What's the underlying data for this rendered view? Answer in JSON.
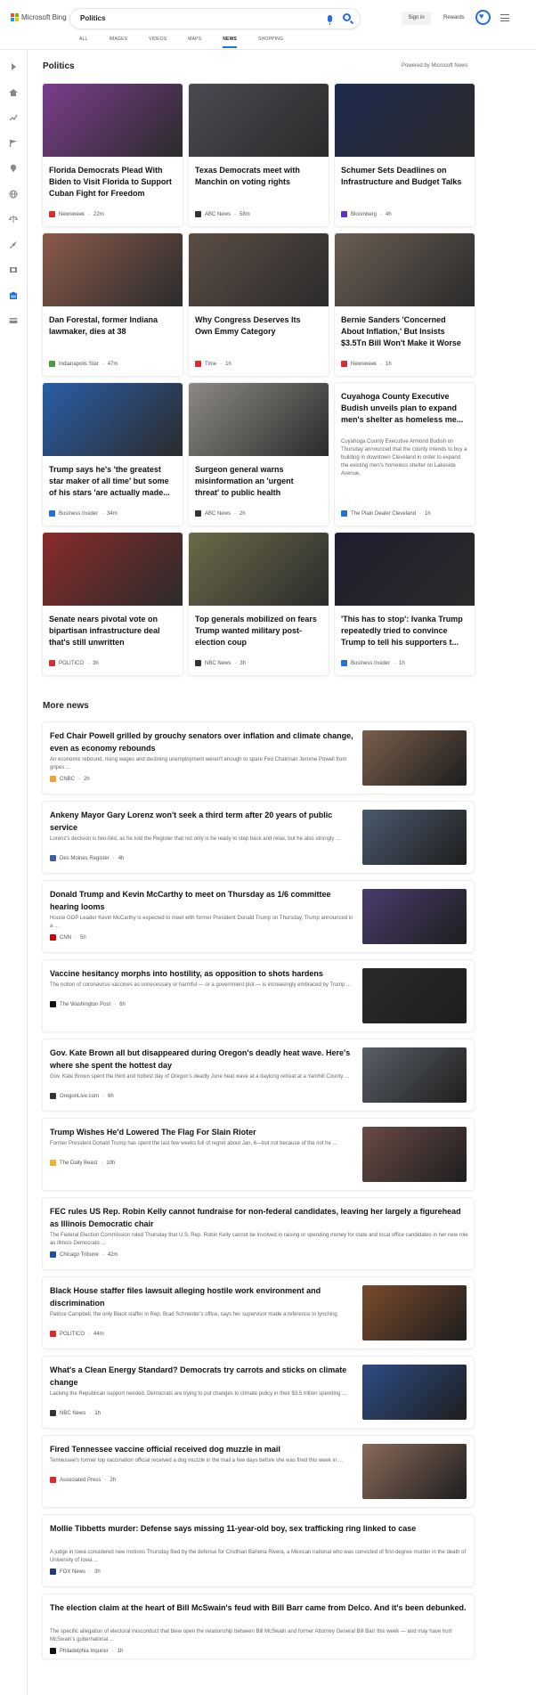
{
  "header": {
    "logo_text": "Microsoft Bing",
    "search_query": "Politics",
    "signin_label": "Sign in",
    "rewards_label": "Rewards",
    "scopes": [
      {
        "label": "ALL",
        "active": false
      },
      {
        "label": "IMAGES",
        "active": false
      },
      {
        "label": "VIDEOS",
        "active": false
      },
      {
        "label": "MAPS",
        "active": false
      },
      {
        "label": "NEWS",
        "active": true
      },
      {
        "label": "SHOPPING",
        "active": false
      }
    ]
  },
  "sidebar": {
    "icons": [
      "expand-arrow-icon",
      "home-icon",
      "trending-icon",
      "flag-icon",
      "location-pin-icon",
      "globe-icon",
      "scales-icon",
      "rocket-icon",
      "film-icon",
      "building-icon",
      "credit-card-icon"
    ]
  },
  "top_section": {
    "title": "Politics",
    "powered_by": "Powered by Microsoft News",
    "cards": [
      {
        "title": "Florida Democrats Plead With Biden to Visit Florida to Support Cuban Fight for Freedom",
        "source": "Newsweek",
        "time": "22m",
        "src_color": "#e0282d",
        "img_color": "#7a3d8c"
      },
      {
        "title": "Texas Democrats meet with Manchin on voting rights",
        "source": "ABC News",
        "time": "58m",
        "src_color": "#333333",
        "img_color": "#4a4a52"
      },
      {
        "title": "Schumer Sets Deadlines on Infrastructure and Budget Talks",
        "source": "Bloomberg",
        "time": "4h",
        "src_color": "#5b2fd6",
        "img_color": "#1d2a4e"
      },
      {
        "title": "Dan Forestal, former Indiana lawmaker, dies at 38",
        "source": "Indianapolis Star",
        "time": "47m",
        "src_color": "#4a9a3f",
        "img_color": "#8a5a4a"
      },
      {
        "title": "Why Congress Deserves Its Own Emmy Category",
        "source": "Time",
        "time": "1h",
        "src_color": "#e0282d",
        "img_color": "#5b4d44"
      },
      {
        "title": "Bernie Sanders 'Concerned About Inflation,' But Insists $3.5Tn Bill Won't Make it Worse",
        "source": "Newsweek",
        "time": "1h",
        "src_color": "#e0282d",
        "img_color": "#6a5d52"
      },
      {
        "title": "Trump says he's 'the greatest star maker of all time' but some of his stars 'are actually made...",
        "source": "Business Insider",
        "time": "34m",
        "src_color": "#1f6fe5",
        "img_color": "#2a5ea8"
      },
      {
        "title": "Surgeon general warns misinformation an 'urgent threat' to public health",
        "source": "ABC News",
        "time": "2h",
        "src_color": "#333333",
        "img_color": "#8d8a84"
      },
      {
        "title": "Cuyahoga County Executive Budish unveils plan to expand men's shelter as homeless me...",
        "snippet": "Cuyahoga County Executive Armond Budish on Thursday announced that the county intends to buy a building in downtown Cleveland in order to expand the existing men's homeless shelter on Lakeside Avenue.",
        "source": "The Plain Dealer Cleveland",
        "time": "1h",
        "src_color": "#1f6fe5",
        "img_color": ""
      },
      {
        "title": "Senate nears pivotal vote on bipartisan infrastructure deal that's still unwritten",
        "source": "POLITICO",
        "time": "3h",
        "src_color": "#e0282d",
        "img_color": "#8a2b2b"
      },
      {
        "title": "Top generals mobilized on fears Trump wanted military post-election coup",
        "source": "NBC News",
        "time": "3h",
        "src_color": "#333333",
        "img_color": "#6b6a4a"
      },
      {
        "title": "'This has to stop': Ivanka Trump repeatedly tried to convince Trump to tell his supporters t...",
        "source": "Business Insider",
        "time": "1h",
        "src_color": "#1f6fe5",
        "img_color": "#1e1e30"
      }
    ]
  },
  "more_news": {
    "title": "More news",
    "items": [
      {
        "title": "Fed Chair Powell grilled by grouchy senators over inflation and climate change, even as economy rebounds",
        "snippet": "An economic rebound, rising wages and declining unemployment weren't enough to spare Fed Chairman Jerome Powell from gripes ...",
        "source": "CNBC",
        "time": "2h",
        "src_color": "#f2a233",
        "thumb_color": "#7a5e4a"
      },
      {
        "title": "Ankeny Mayor Gary Lorenz won't seek a third term after 20 years of public service",
        "snippet": "Lorenz's decision is two-fold, as he told the Register that not only is he ready to step back and relax, but he also strongly ...",
        "source": "Des Moines Register",
        "time": "4h",
        "src_color": "#3a5fb0",
        "thumb_color": "#4a5a6e"
      },
      {
        "title": "Donald Trump and Kevin McCarthy to meet on Thursday as 1/6 committee hearing looms",
        "snippet": "House GOP Leader Kevin McCarthy is expected to meet with former President Donald Trump on Thursday, Trump announced in a ...",
        "source": "CNN",
        "time": "5h",
        "src_color": "#cc0000",
        "thumb_color": "#4a3b6e"
      },
      {
        "title": "Vaccine hesitancy morphs into hostility, as opposition to shots hardens",
        "snippet": "The notion of coronavirus vaccines as unnecessary or harmful — or a government plot — is increasingly embraced by Trump ...",
        "source": "The Washington Post",
        "time": "6h",
        "src_color": "#111111",
        "thumb_color": "#2a2a2a"
      },
      {
        "title": "Gov. Kate Brown all but disappeared during Oregon's deadly heat wave. Here's where she spent the hottest day",
        "snippet": "Gov. Kate Brown spent the third and hottest day of Oregon's deadly June heat wave at a daylong retreat at a Yamhill County ...",
        "source": "OregonLive.com",
        "time": "6h",
        "src_color": "#333333",
        "thumb_color": "#5a6068"
      },
      {
        "title": "Trump Wishes He'd Lowered The Flag For Slain Rioter",
        "snippet": "Former President Donald Trump has spent the last few weeks full of regret about Jan. 6—but not because of the riot he ...",
        "source": "The Daily Beast",
        "time": "10h",
        "src_color": "#f2b233",
        "thumb_color": "#6a4a44"
      },
      {
        "title": "FEC rules US Rep. Robin Kelly cannot fundraise for non-federal candidates, leaving her largely a figurehead as Illinois Democratic chair",
        "snippet": "The Federal Election Commission ruled Thursday that U.S. Rep. Robin Kelly cannot be involved in raising or spending money for state and local office candidates in her new role as Illinois Democratic ...",
        "source": "Chicago Tribune",
        "time": "42m",
        "src_color": "#1f4fa5",
        "thumb_color": ""
      },
      {
        "title": "Black House staffer files lawsuit alleging hostile work environment and discrimination",
        "snippet": "Patrice Campbell, the only Black staffer in Rep. Brad Schneider's office, says her supervisor made a reference to lynching",
        "source": "POLITICO",
        "time": "44m",
        "src_color": "#e0282d",
        "thumb_color": "#7a4a2a"
      },
      {
        "title": "What's a Clean Energy Standard? Democrats try carrots and sticks on climate change",
        "snippet": "Lacking the Republican support needed, Democrats are trying to put changes to climate policy in their $3.5 trillion spending ...",
        "source": "NBC News",
        "time": "1h",
        "src_color": "#333333",
        "thumb_color": "#2e4c86"
      },
      {
        "title": "Fired Tennessee vaccine official received dog muzzle in mail",
        "snippet": "Tennessee's former top vaccination official received a dog muzzle in the mail a few days before she was fired this week in ...",
        "source": "Associated Press",
        "time": "2h",
        "src_color": "#e0282d",
        "thumb_color": "#8a6a5a"
      },
      {
        "title": "Mollie Tibbetts murder: Defense says missing 11-year-old boy, sex trafficking ring linked to case",
        "snippet": "A judge in Iowa considered new motions Thursday filed by the defense for Cristhian Bahena Rivera, a Mexican national who was convicted of first-degree murder in the death of University of Iowa ...",
        "source": "FOX News",
        "time": "3h",
        "src_color": "#1f3a7a",
        "thumb_color": ""
      },
      {
        "title": "The election claim at the heart of Bill McSwain's feud with Bill Barr came from Delco. And it's been debunked.",
        "snippet": "The specific allegation of electoral misconduct that blew open the relationship between Bill McSwain and former Attorney General Bill Barr this week — and may have hurt McSwain's gubernatorial ...",
        "source": "Philadelphia Inquirer",
        "time": "1h",
        "src_color": "#111111",
        "thumb_color": ""
      }
    ]
  }
}
